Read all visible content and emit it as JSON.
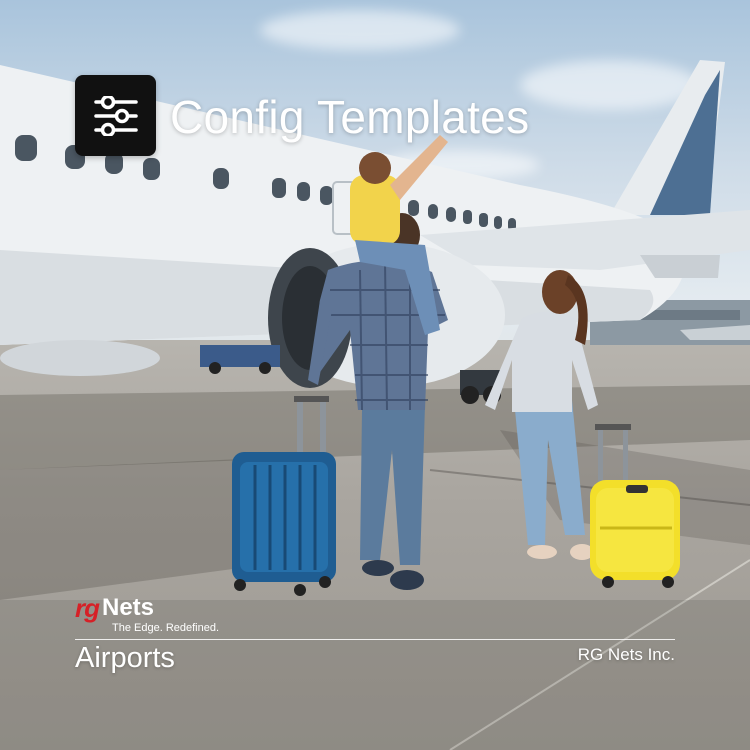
{
  "header": {
    "icon": "sliders-icon",
    "title": "Config Templates"
  },
  "brand": {
    "logo_rg": "rg",
    "logo_nets": "Nets",
    "tagline": "The Edge. Redefined."
  },
  "footer": {
    "category": "Airports",
    "company": "RG Nets Inc."
  },
  "colors": {
    "brand_red": "#d62027",
    "badge_bg": "#111111",
    "text": "#ffffff"
  }
}
